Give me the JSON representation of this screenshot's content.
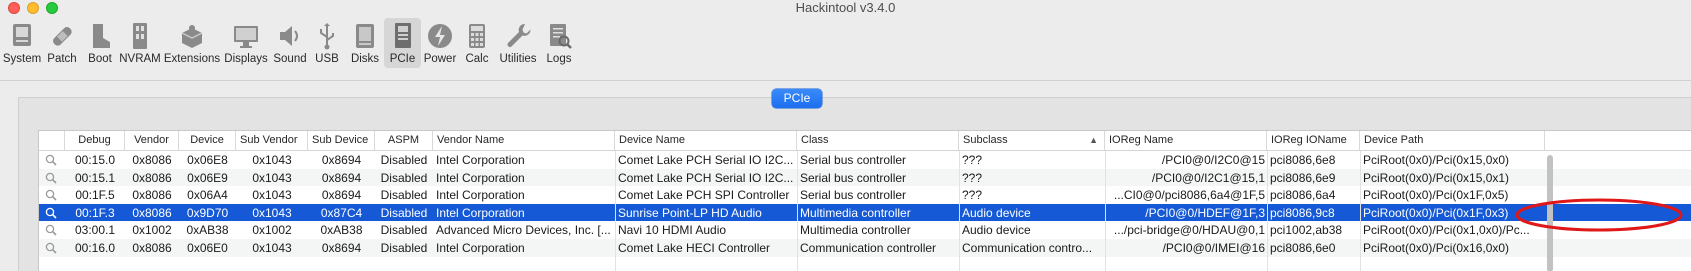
{
  "window": {
    "title": "Hackintool v3.4.0"
  },
  "toolbar": {
    "items": [
      {
        "label": "System",
        "icon": "system-icon"
      },
      {
        "label": "Patch",
        "icon": "bandage-icon"
      },
      {
        "label": "Boot",
        "icon": "boot-icon"
      },
      {
        "label": "NVRAM",
        "icon": "nvram-icon"
      },
      {
        "label": "Extensions",
        "icon": "extensions-icon"
      },
      {
        "label": "Displays",
        "icon": "display-icon"
      },
      {
        "label": "Sound",
        "icon": "speaker-icon"
      },
      {
        "label": "USB",
        "icon": "usb-icon"
      },
      {
        "label": "Disks",
        "icon": "disk-icon"
      },
      {
        "label": "PCIe",
        "icon": "pcie-icon"
      },
      {
        "label": "Power",
        "icon": "power-icon"
      },
      {
        "label": "Calc",
        "icon": "calculator-icon"
      },
      {
        "label": "Utilities",
        "icon": "wrench-icon"
      },
      {
        "label": "Logs",
        "icon": "logs-icon"
      }
    ],
    "selected": "PCIe"
  },
  "segment": {
    "label": "PCIe"
  },
  "table": {
    "columns": [
      "Debug",
      "Vendor",
      "Device",
      "Sub Vendor",
      "Sub Device",
      "ASPM",
      "Vendor Name",
      "Device Name",
      "Class",
      "Subclass",
      "IOReg Name",
      "IOReg IOName",
      "Device Path"
    ],
    "sorted_column": "Subclass",
    "rows": [
      {
        "debug": "00:15.0",
        "vendor": "0x8086",
        "device": "0x06E8",
        "sub_vendor": "0x1043",
        "sub_device": "0x8694",
        "aspm": "Disabled",
        "vendor_name": "Intel Corporation",
        "device_name": "Comet Lake PCH Serial IO I2C...",
        "class": "Serial bus controller",
        "subclass": "???",
        "ioreg_name": "/PCI0@0/I2C0@15",
        "ioreg_ioname": "pci8086,6e8",
        "device_path": "PciRoot(0x0)/Pci(0x15,0x0)"
      },
      {
        "debug": "00:15.1",
        "vendor": "0x8086",
        "device": "0x06E9",
        "sub_vendor": "0x1043",
        "sub_device": "0x8694",
        "aspm": "Disabled",
        "vendor_name": "Intel Corporation",
        "device_name": "Comet Lake PCH Serial IO I2C...",
        "class": "Serial bus controller",
        "subclass": "???",
        "ioreg_name": "/PCI0@0/I2C1@15,1",
        "ioreg_ioname": "pci8086,6e9",
        "device_path": "PciRoot(0x0)/Pci(0x15,0x1)"
      },
      {
        "debug": "00:1F.5",
        "vendor": "0x8086",
        "device": "0x06A4",
        "sub_vendor": "0x1043",
        "sub_device": "0x8694",
        "aspm": "Disabled",
        "vendor_name": "Intel Corporation",
        "device_name": "Comet Lake PCH SPI Controller",
        "class": "Serial bus controller",
        "subclass": "???",
        "ioreg_name": "...CI0@0/pci8086,6a4@1F,5",
        "ioreg_ioname": "pci8086,6a4",
        "device_path": "PciRoot(0x0)/Pci(0x1F,0x5)"
      },
      {
        "debug": "00:1F.3",
        "vendor": "0x8086",
        "device": "0x9D70",
        "sub_vendor": "0x1043",
        "sub_device": "0x87C4",
        "aspm": "Disabled",
        "vendor_name": "Intel Corporation",
        "device_name": "Sunrise Point-LP HD Audio",
        "class": "Multimedia controller",
        "subclass": "Audio device",
        "ioreg_name": "/PCI0@0/HDEF@1F,3",
        "ioreg_ioname": "pci8086,9c8",
        "device_path": "PciRoot(0x0)/Pci(0x1F,0x3)"
      },
      {
        "debug": "03:00.1",
        "vendor": "0x1002",
        "device": "0xAB38",
        "sub_vendor": "0x1002",
        "sub_device": "0xAB38",
        "aspm": "Disabled",
        "vendor_name": "Advanced Micro Devices, Inc. [...",
        "device_name": "Navi 10 HDMI Audio",
        "class": "Multimedia controller",
        "subclass": "Audio device",
        "ioreg_name": ".../pci-bridge@0/HDAU@0,1",
        "ioreg_ioname": "pci1002,ab38",
        "device_path": "PciRoot(0x0)/Pci(0x1,0x0)/Pc..."
      },
      {
        "debug": "00:16.0",
        "vendor": "0x8086",
        "device": "0x06E0",
        "sub_vendor": "0x1043",
        "sub_device": "0x8694",
        "aspm": "Disabled",
        "vendor_name": "Intel Corporation",
        "device_name": "Comet Lake HECI Controller",
        "class": "Communication controller",
        "subclass": "Communication contro...",
        "ioreg_name": "/PCI0@0/IMEI@16",
        "ioreg_ioname": "pci8086,6e0",
        "device_path": "PciRoot(0x0)/Pci(0x16,0x0)"
      }
    ],
    "selected_row": 3
  },
  "colors": {
    "selection": "#1559d6",
    "segment": "#1d6ef0",
    "annotation": "#e01818"
  }
}
